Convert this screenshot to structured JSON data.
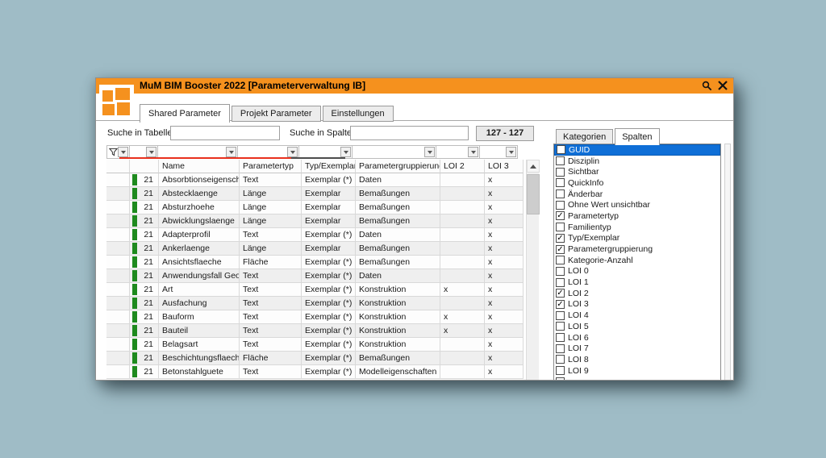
{
  "window": {
    "title": "MuM BIM Booster 2022  [Parameterverwaltung IB]",
    "tabs": [
      "Shared Parameter",
      "Projekt Parameter",
      "Einstellungen"
    ],
    "active_tab": "Shared Parameter"
  },
  "colors": {
    "titlebar_orange": "#f5911e",
    "selection_blue": "#0f6fd7",
    "row_indicator_green": "#1e8a1e",
    "filter_underline_red": "#e8301d",
    "background": "#9fbcc6"
  },
  "icons": {
    "titlebar": [
      "search-icon",
      "close-icon"
    ],
    "filter": "funnel-icon"
  },
  "search": {
    "table_label": "Suche in Tabelle",
    "table_value": "",
    "columns_label": "Suche in Spalten",
    "columns_value": "",
    "counter": "127 - 127"
  },
  "table": {
    "columns": [
      "",
      "",
      "Name",
      "Parametertyp",
      "Typ/Exemplar",
      "Parametergruppierung",
      "LOI 2",
      "LOI 3"
    ],
    "rows": [
      [
        "21",
        "Absorbtionseigenschaft",
        "Text",
        "Exemplar (*)",
        "Daten",
        "",
        "x"
      ],
      [
        "21",
        "Abstecklaenge",
        "Länge",
        "Exemplar",
        "Bemaßungen",
        "",
        "x"
      ],
      [
        "21",
        "Absturzhoehe",
        "Länge",
        "Exemplar",
        "Bemaßungen",
        "",
        "x"
      ],
      [
        "21",
        "Abwicklungslaenge",
        "Länge",
        "Exemplar",
        "Bemaßungen",
        "",
        "x"
      ],
      [
        "21",
        "Adapterprofil",
        "Text",
        "Exemplar (*)",
        "Daten",
        "",
        "x"
      ],
      [
        "21",
        "Ankerlaenge",
        "Länge",
        "Exemplar",
        "Bemaßungen",
        "",
        "x"
      ],
      [
        "21",
        "Ansichtsflaeche",
        "Fläche",
        "Exemplar (*)",
        "Bemaßungen",
        "",
        "x"
      ],
      [
        "21",
        "Anwendungsfall Geoku...",
        "Text",
        "Exemplar (*)",
        "Daten",
        "",
        "x"
      ],
      [
        "21",
        "Art",
        "Text",
        "Exemplar (*)",
        "Konstruktion",
        "x",
        "x"
      ],
      [
        "21",
        "Ausfachung",
        "Text",
        "Exemplar (*)",
        "Konstruktion",
        "",
        "x"
      ],
      [
        "21",
        "Bauform",
        "Text",
        "Exemplar (*)",
        "Konstruktion",
        "x",
        "x"
      ],
      [
        "21",
        "Bauteil",
        "Text",
        "Exemplar (*)",
        "Konstruktion",
        "x",
        "x"
      ],
      [
        "21",
        "Belagsart",
        "Text",
        "Exemplar (*)",
        "Konstruktion",
        "",
        "x"
      ],
      [
        "21",
        "Beschichtungsflaeche",
        "Fläche",
        "Exemplar (*)",
        "Bemaßungen",
        "",
        "x"
      ],
      [
        "21",
        "Betonstahlguete",
        "Text",
        "Exemplar (*)",
        "Modelleigenschaften",
        "",
        "x"
      ]
    ]
  },
  "panel": {
    "tabs": [
      "Kategorien",
      "Spalten"
    ],
    "active_tab": "Spalten",
    "items": [
      {
        "label": "GUID",
        "checked": false,
        "selected": true
      },
      {
        "label": "Disziplin",
        "checked": false,
        "selected": false
      },
      {
        "label": "Sichtbar",
        "checked": false,
        "selected": false
      },
      {
        "label": "QuickInfo",
        "checked": false,
        "selected": false
      },
      {
        "label": "Änderbar",
        "checked": false,
        "selected": false
      },
      {
        "label": "Ohne Wert unsichtbar",
        "checked": false,
        "selected": false
      },
      {
        "label": "Parametertyp",
        "checked": true,
        "selected": false
      },
      {
        "label": "Familientyp",
        "checked": false,
        "selected": false
      },
      {
        "label": "Typ/Exemplar",
        "checked": true,
        "selected": false
      },
      {
        "label": "Parametergruppierung",
        "checked": true,
        "selected": false
      },
      {
        "label": "Kategorie-Anzahl",
        "checked": false,
        "selected": false
      },
      {
        "label": "LOI 0",
        "checked": false,
        "selected": false
      },
      {
        "label": "LOI 1",
        "checked": false,
        "selected": false
      },
      {
        "label": "LOI 2",
        "checked": true,
        "selected": false
      },
      {
        "label": "LOI 3",
        "checked": true,
        "selected": false
      },
      {
        "label": "LOI 4",
        "checked": false,
        "selected": false
      },
      {
        "label": "LOI 5",
        "checked": false,
        "selected": false
      },
      {
        "label": "LOI 6",
        "checked": false,
        "selected": false
      },
      {
        "label": "LOI 7",
        "checked": false,
        "selected": false
      },
      {
        "label": "LOI 8",
        "checked": false,
        "selected": false
      },
      {
        "label": "LOI 9",
        "checked": false,
        "selected": false
      },
      {
        "label": "",
        "checked": false,
        "selected": false
      }
    ]
  }
}
